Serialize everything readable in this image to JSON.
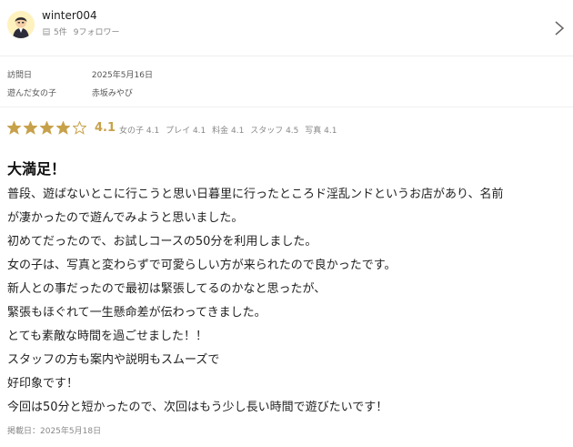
{
  "user": {
    "username": "winter004",
    "review_count": "5件",
    "followers": "9フォロワー",
    "avatar_icon": "user-avatar-icon",
    "review_count_icon": "document-icon"
  },
  "visit_info": {
    "visit_date_label": "訪問日",
    "visit_date_value": "2025年5月16日",
    "girl_label": "遊んだ女の子",
    "girl_value": "赤坂みやび"
  },
  "rating": {
    "score": "4.1",
    "stars_filled": 4,
    "stars_total": 5,
    "star_color": "#c7a14a",
    "subscores": [
      "女の子 4.1",
      "プレイ 4.1",
      "料金 4.1",
      "スタッフ 4.5",
      "写真 4.1"
    ]
  },
  "review": {
    "title": "大満足！",
    "lines": [
      "普段、遊ばないとこに行こうと思い日暮里に行ったところド淫乱ンドというお店があり、名前",
      "が凄かったので遊んでみようと思いました。",
      "初めてだったので、お試しコースの50分を利用しました。",
      "女の子は、写真と変わらずで可愛らしい方が来られたので良かったです。",
      "新人との事だったので最初は緊張してるのかなと思ったが、",
      "緊張もほぐれて一生懸命差が伝わってきました。",
      "とても素敵な時間を過ごせました！！",
      "スタッフの方も案内や説明もスムーズで",
      "好印象です！",
      "今回は50分と短かったので、次回はもう少し長い時間で遊びたいです！"
    ],
    "posted_date": "掲載日：2025年5月18日"
  }
}
